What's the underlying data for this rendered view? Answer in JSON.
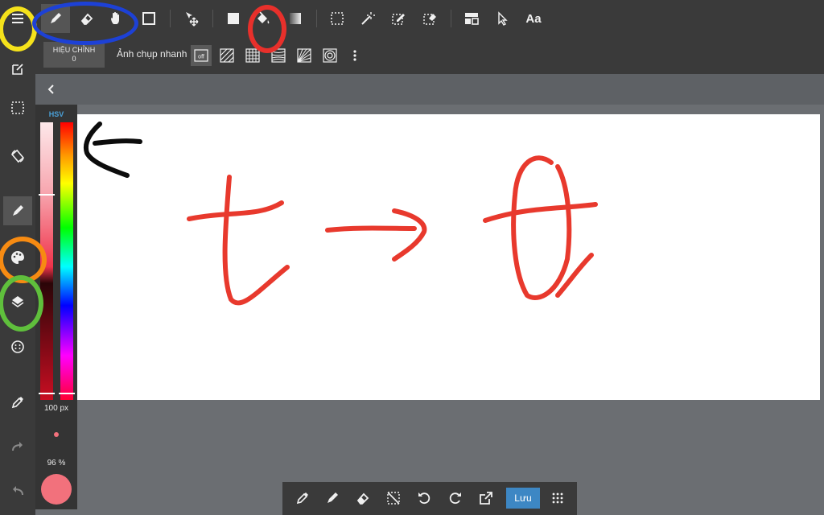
{
  "toolbar": {
    "tools": [
      {
        "name": "pencil-tool",
        "icon": "pencil-icon",
        "active": true
      },
      {
        "name": "eraser-tool",
        "icon": "eraser-icon"
      },
      {
        "name": "hand-tool",
        "icon": "hand-icon"
      },
      {
        "name": "shape-tool",
        "icon": "square-outline-icon"
      },
      {
        "name": "move-tool",
        "icon": "move-icon"
      },
      {
        "name": "fill-color-tool",
        "icon": "square-fill-icon"
      },
      {
        "name": "bucket-tool",
        "icon": "paint-bucket-icon"
      },
      {
        "name": "gradient-tool",
        "icon": "gradient-icon"
      },
      {
        "name": "select-rect-tool",
        "icon": "select-rect-icon"
      },
      {
        "name": "magic-wand-tool",
        "icon": "magic-wand-icon"
      },
      {
        "name": "select-pen-tool",
        "icon": "select-pen-icon"
      },
      {
        "name": "select-eraser-tool",
        "icon": "select-eraser-icon"
      },
      {
        "name": "frame-divider-tool",
        "icon": "frame-icon"
      },
      {
        "name": "operation-tool",
        "icon": "pointer-icon"
      },
      {
        "name": "text-tool",
        "icon": "text-icon",
        "label": "Aa"
      }
    ]
  },
  "correction": {
    "label": "HIỆU CHỈNH",
    "value": "0"
  },
  "snapshot": {
    "label": "Ảnh chụp nhanh",
    "off_label": "off",
    "options": [
      "snap-parallel-icon",
      "snap-grid-icon",
      "snap-perspective-icon",
      "snap-radial-icon",
      "snap-circle-icon",
      "more-vertical-icon"
    ]
  },
  "sidebar": {
    "items": [
      "menu-icon",
      "edit-icon",
      "selection-icon",
      "rotate-icon",
      "brush-icon",
      "palette-icon",
      "layers-icon",
      "material-icon",
      "eyedropper-icon",
      "redo-icon",
      "undo-icon"
    ]
  },
  "palette": {
    "mode": "HSV",
    "brush_size": "100 px",
    "opacity": "96 %",
    "color": "#f2717c"
  },
  "bottom_toolbar": {
    "items": [
      "eyedropper-icon",
      "pen-icon",
      "eraser-icon",
      "deselect-icon",
      "rotate-ccw-icon",
      "rotate-cw-icon",
      "transform-icon"
    ],
    "save_label": "Lưu",
    "menu": "grid-menu-icon"
  },
  "annotations": {
    "colors": {
      "yellow": "#f5e21b",
      "blue": "#1d41d6",
      "red": "#e8302b",
      "orange": "#f78b12",
      "green": "#5fbf3c",
      "black": "#0c0c0c"
    }
  },
  "drawing": {
    "stroke_color": "#e8392d"
  }
}
